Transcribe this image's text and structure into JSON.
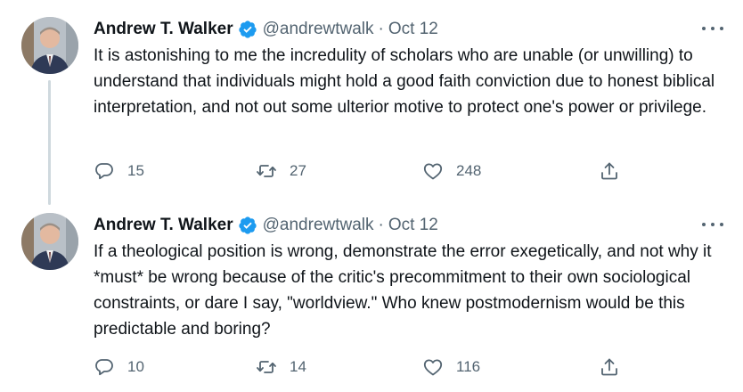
{
  "colors": {
    "verified_badge": "#1d9bf0",
    "secondary_text": "#536471",
    "primary_text": "#0f1419",
    "thread_line": "#cfd9de"
  },
  "icons": {
    "verified": "verified-badge-icon",
    "more": "more-horizontal-icon",
    "reply": "reply-icon",
    "retweet": "retweet-icon",
    "like": "heart-icon",
    "share": "share-icon"
  },
  "tweets": [
    {
      "author_name": "Andrew T. Walker",
      "handle": "@andrewtwalk",
      "separator": "·",
      "date": "Oct 12",
      "text": "It is astonishing to me the incredulity of scholars who are unable (or unwilling) to understand that individuals might hold a good faith conviction due to honest biblical interpretation, and not out some ulterior motive to protect one's power or privilege.",
      "replies": "15",
      "retweets": "27",
      "likes": "248"
    },
    {
      "author_name": "Andrew T. Walker",
      "handle": "@andrewtwalk",
      "separator": "·",
      "date": "Oct 12",
      "text": "If a theological position is wrong, demonstrate the error exegetically, and not why it *must* be wrong because of the critic's precommitment to their own sociological constraints, or dare I say, \"worldview.\" Who knew postmodernism would be this predictable and boring?",
      "replies": "10",
      "retweets": "14",
      "likes": "116"
    }
  ]
}
